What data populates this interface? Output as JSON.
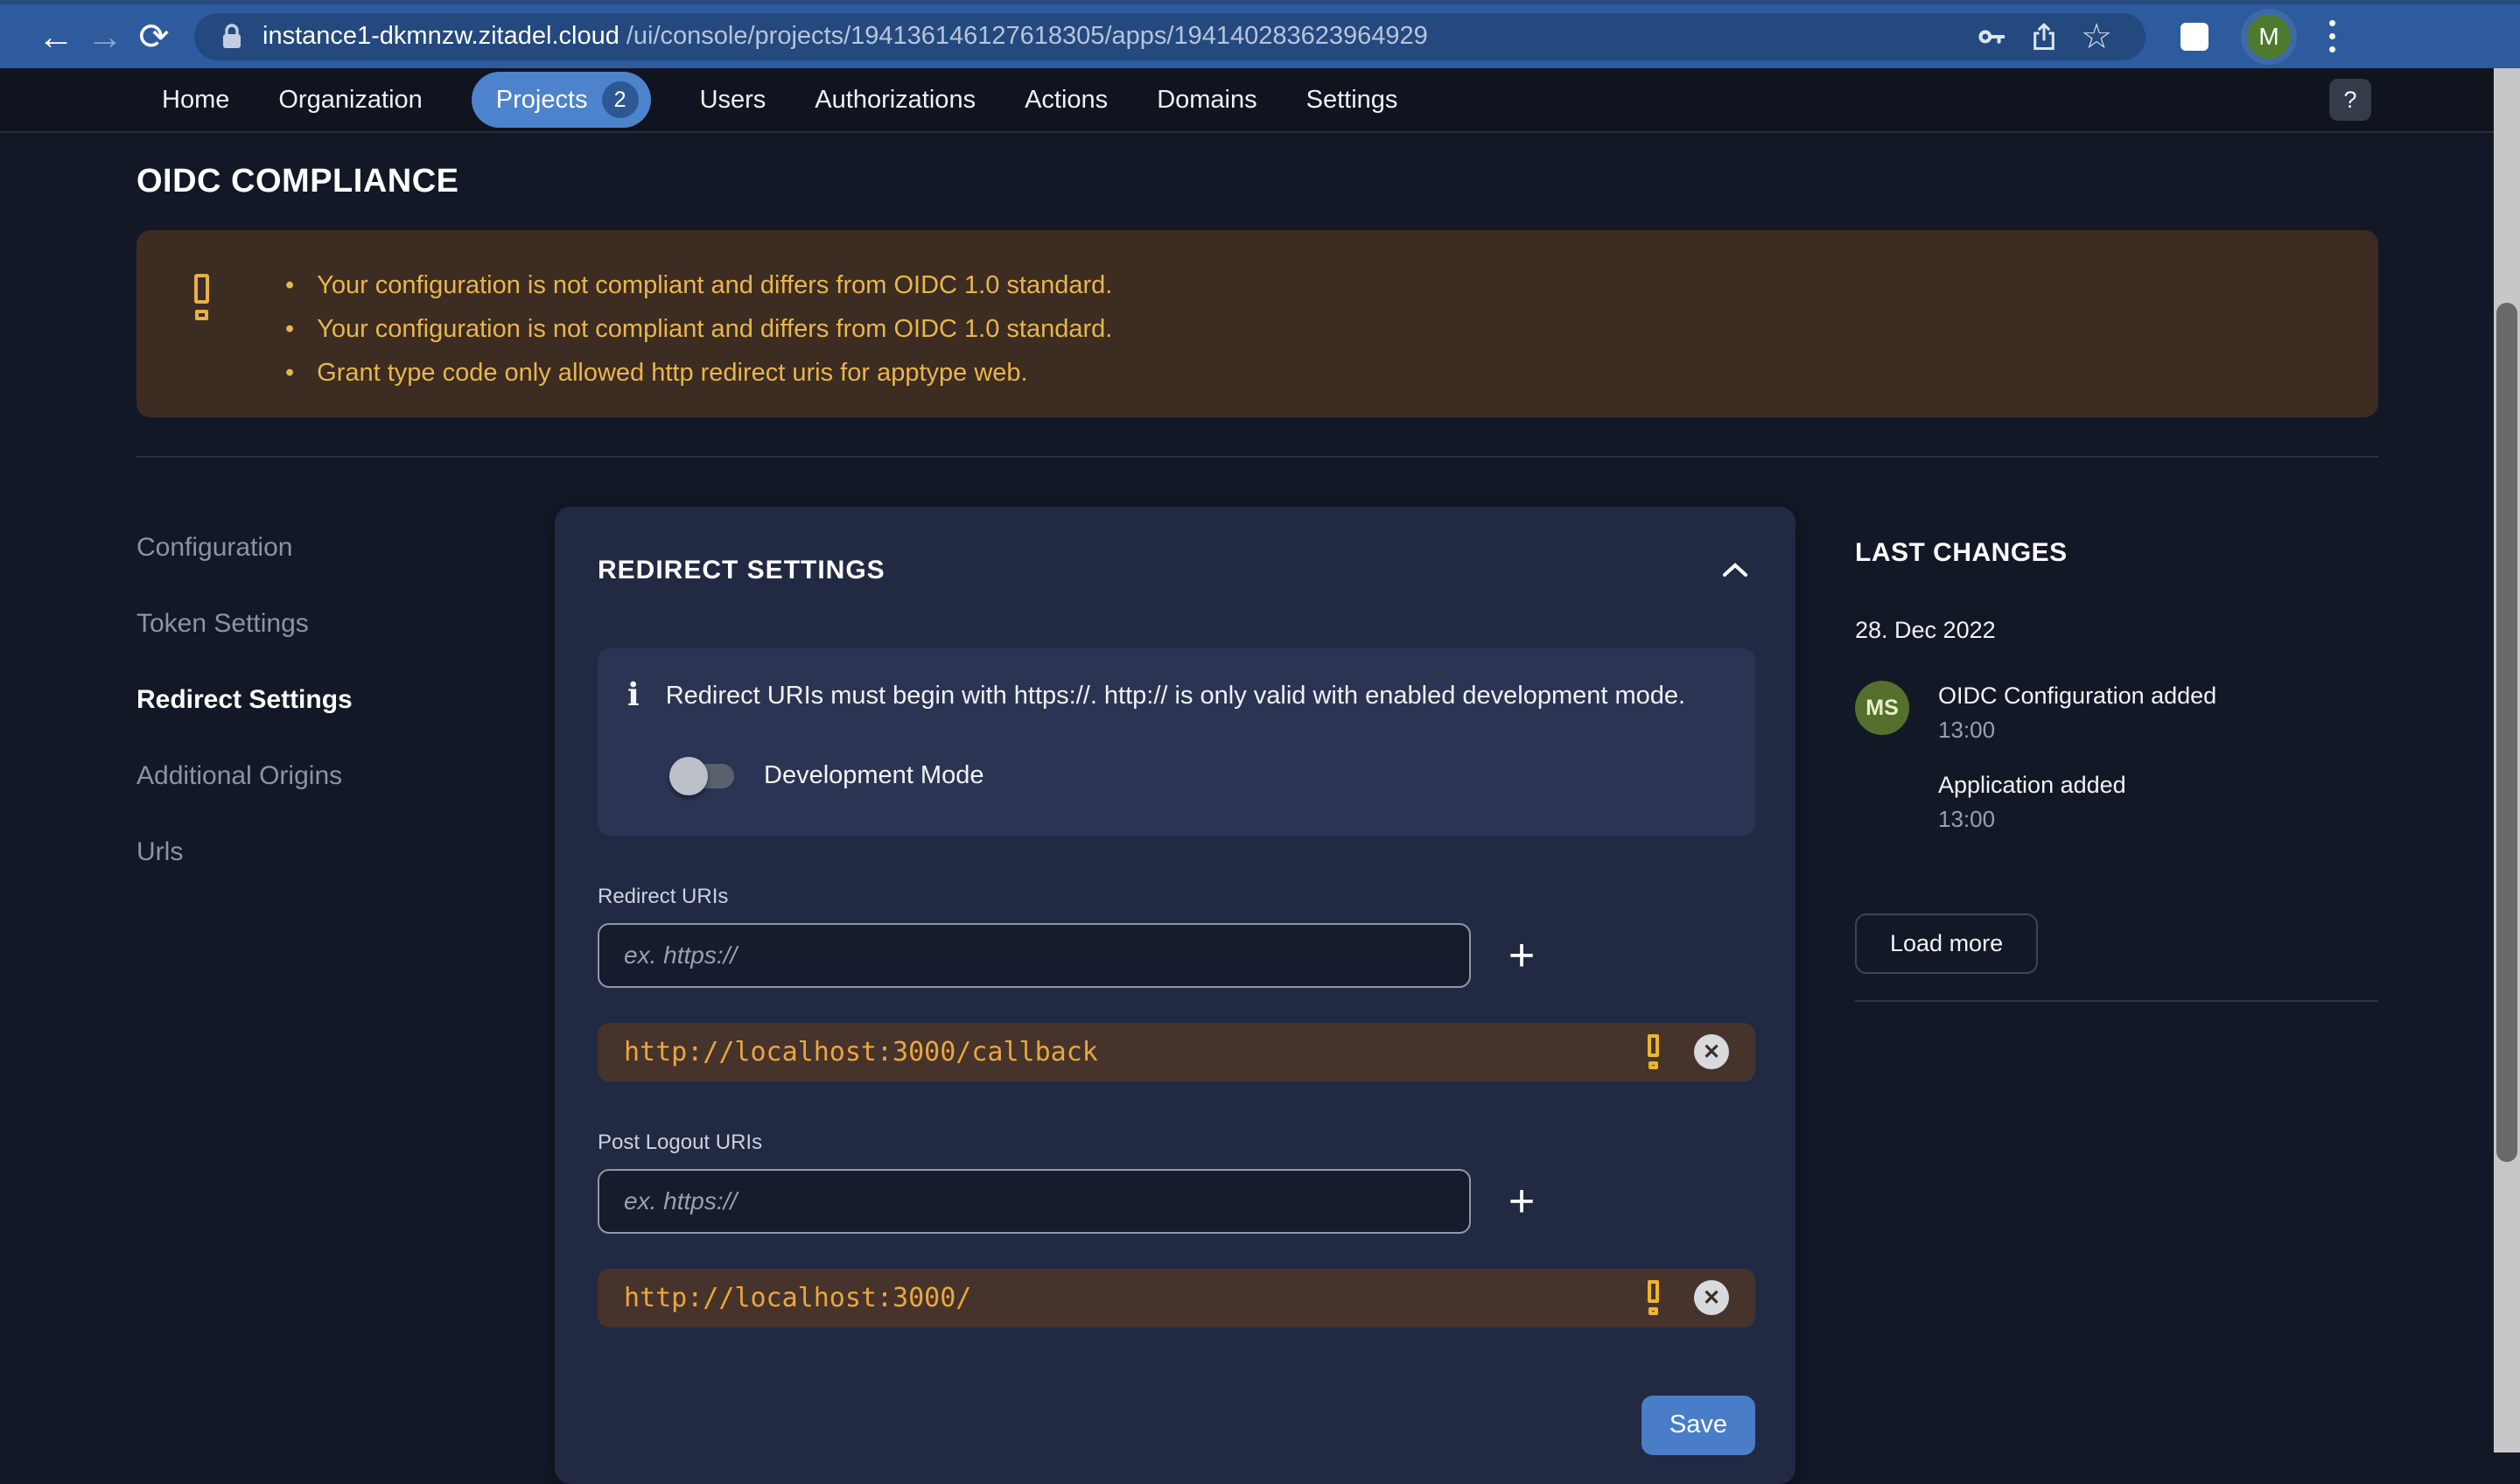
{
  "browser": {
    "url_domain": "instance1-dkmnzw.zitadel.cloud",
    "url_path": "/ui/console/projects/194136146127618305/apps/194140283623964929",
    "avatar_initial": "M"
  },
  "icons": {
    "back": "←",
    "forward": "→",
    "reload": "⟳",
    "star": "☆",
    "plus": "+",
    "close": "✕",
    "info": "ℹ"
  },
  "nav": {
    "items": [
      "Home",
      "Organization",
      "Projects",
      "Users",
      "Authorizations",
      "Actions",
      "Domains",
      "Settings"
    ],
    "projects_badge": "2",
    "help_label": "?"
  },
  "page": {
    "title": "OIDC COMPLIANCE",
    "warnings": [
      "Your configuration is not compliant and differs from OIDC 1.0 standard.",
      "Your configuration is not compliant and differs from OIDC 1.0 standard.",
      "Grant type code only allowed http redirect uris for apptype web."
    ]
  },
  "side_menu": {
    "items": [
      "Configuration",
      "Token Settings",
      "Redirect Settings",
      "Additional Origins",
      "Urls"
    ],
    "active": "Redirect Settings"
  },
  "redirect_card": {
    "title": "REDIRECT SETTINGS",
    "info_text": "Redirect URIs must begin with https://. http:// is only valid with enabled development mode.",
    "dev_mode_label": "Development Mode",
    "dev_mode_enabled": false,
    "redirect_uris_label": "Redirect URIs",
    "post_logout_label": "Post Logout URIs",
    "input_placeholder": "ex. https://",
    "redirect_uri_value": "http://localhost:3000/callback",
    "post_logout_uri_value": "http://localhost:3000/",
    "save_label": "Save"
  },
  "last_changes": {
    "title": "LAST CHANGES",
    "date": "28. Dec 2022",
    "avatar_initials": "MS",
    "events": [
      {
        "title": "OIDC Configuration added",
        "time": "13:00"
      },
      {
        "title": "Application added",
        "time": "13:00"
      }
    ],
    "load_more_label": "Load more"
  },
  "colors": {
    "chrome_blue": "#2e5a9e",
    "accent_blue": "#4d83cc",
    "warning_text": "#e8b64e",
    "warning_bg": "#3c2c21",
    "uri_chip_bg": "#46332b",
    "uri_text": "#eaa73e",
    "card_bg": "#212943",
    "page_bg": "#131826",
    "avatar_green": "#4d7a2e"
  }
}
